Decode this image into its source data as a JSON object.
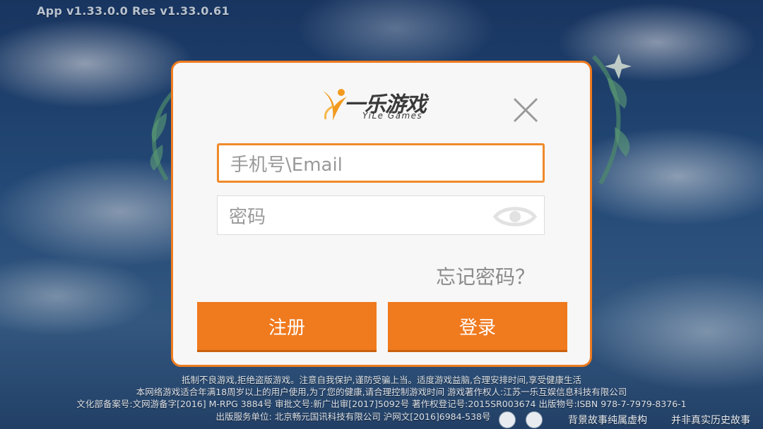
{
  "version_text": "App  v1.33.0.0  Res  v1.33.0.61",
  "dialog": {
    "logo_title": "一乐游戏",
    "logo_sub": "YiLe Games",
    "account_placeholder": "手机号\\Email",
    "password_placeholder": "密码",
    "forgot_label": "忘记密码？",
    "register_label": "注册",
    "login_label": "登录"
  },
  "footer": {
    "line1": "抵制不良游戏,拒绝盗版游戏。注意自我保护,谨防受骗上当。适度游戏益脑,合理安排时间,享受健康生活",
    "line2": "本网络游戏适合年满18周岁以上的用户使用,为了您的健康,请合理控制游戏时间  游戏著作权人:江苏一乐互娱信息科技有限公司",
    "line3": "文化部备案号:文网游备字[2016] M-RPG 3884号  审批文号:新广出审[2017]5092号  著作权登记号:2015SR003674  出版物号:ISBN 978-7-7979-8376-1",
    "line4": "出版服务单位: 北京畅元国讯科技有限公司  沪网文[2016]6984-538号",
    "right1": "背景故事纯属虚构",
    "right2": "并非真实历史故事"
  },
  "colors": {
    "accent": "#f07a1e",
    "dialog_border": "#ee7b1f",
    "dialog_bg": "#f7f7f7"
  },
  "icons": {
    "logo": "yile-logo-icon",
    "close": "close-icon",
    "eye": "eye-icon"
  }
}
